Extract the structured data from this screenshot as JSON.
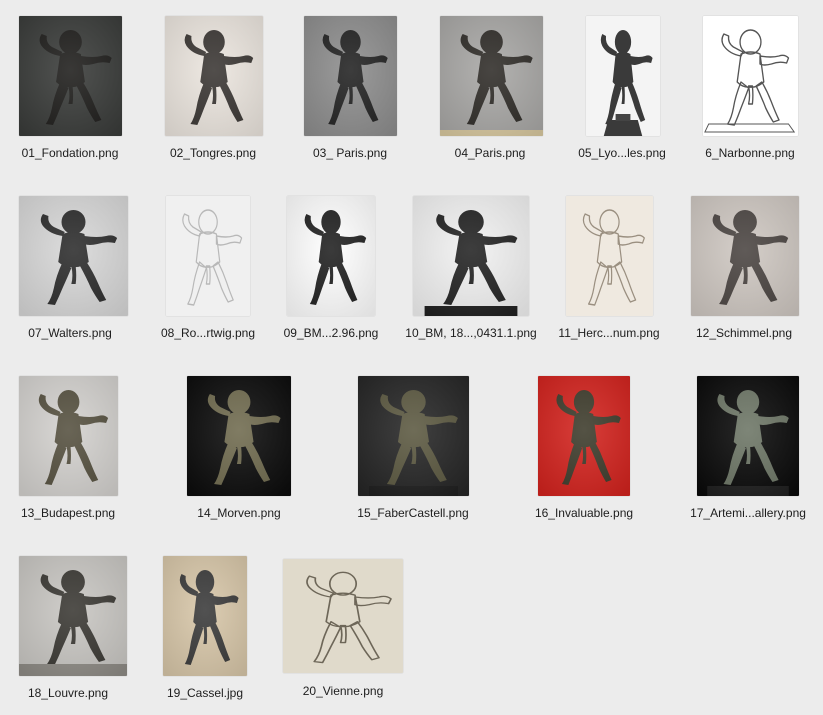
{
  "files": [
    {
      "name": "01_Fondation.png",
      "bg": "#3a3c3a",
      "fig": "#1e1d1b",
      "style": "photo"
    },
    {
      "name": "02_Tongres.png",
      "bg": "#ece6df",
      "fig": "#3a3633",
      "style": "photo"
    },
    {
      "name": "03_ Paris.png",
      "bg": "#8e8e8e",
      "fig": "#222222",
      "style": "photo"
    },
    {
      "name": "04_Paris.png",
      "bg": "#a9a8a6",
      "fig": "#2f2c28",
      "style": "photo"
    },
    {
      "name": "05_Lyo...les.png",
      "bg": "#f4f4f4",
      "fig": "#3a3a3a",
      "style": "pedestal"
    },
    {
      "name": "6_Narbonne.png",
      "bg": "#ffffff",
      "fig": "#555555",
      "style": "drawing"
    },
    {
      "name": "07_Walters.png",
      "bg": "#d8d8d8",
      "fig": "#2c2c2c",
      "style": "photo"
    },
    {
      "name": "08_Ro...rtwig.png",
      "bg": "#f0f0f0",
      "fig": "#b8b8b8",
      "style": "drawing"
    },
    {
      "name": "09_BM...2.96.png",
      "bg": "#ffffff",
      "fig": "#202020",
      "style": "photo"
    },
    {
      "name": "10_BM, 18...,0431.1.png",
      "bg": "#f2f2f2",
      "fig": "#232323",
      "style": "photo"
    },
    {
      "name": "11_Herc...num.png",
      "bg": "#efe9e0",
      "fig": "#9a8f80",
      "style": "sketch"
    },
    {
      "name": "12_Schimmel.png",
      "bg": "#cfc8c2",
      "fig": "#4a4441",
      "style": "photo"
    },
    {
      "name": "13_Budapest.png",
      "bg": "#d4d2cf",
      "fig": "#55503f",
      "style": "photo"
    },
    {
      "name": "14_Morven.png",
      "bg": "#0c0c0c",
      "fig": "#6f6a4e",
      "style": "photo"
    },
    {
      "name": "15_FaberCastell.png",
      "bg": "#262626",
      "fig": "#5b5840",
      "style": "photo"
    },
    {
      "name": "16_Invaluable.png",
      "bg": "#d3231e",
      "fig": "#3d3b2b",
      "style": "photo"
    },
    {
      "name": "17_Artemi...allery.png",
      "bg": "#0a0a0a",
      "fig": "#6c7565",
      "style": "photo"
    },
    {
      "name": "18_Louvre.png",
      "bg": "#c9c7c3",
      "fig": "#3a3833",
      "style": "photo"
    },
    {
      "name": "19_Cassel.jpg",
      "bg": "#d8c7a9",
      "fig": "#3a3a3a",
      "style": "photo"
    },
    {
      "name": "20_Vienne.png",
      "bg": "#e0dacb",
      "fig": "#6d6658",
      "style": "drawing"
    }
  ]
}
